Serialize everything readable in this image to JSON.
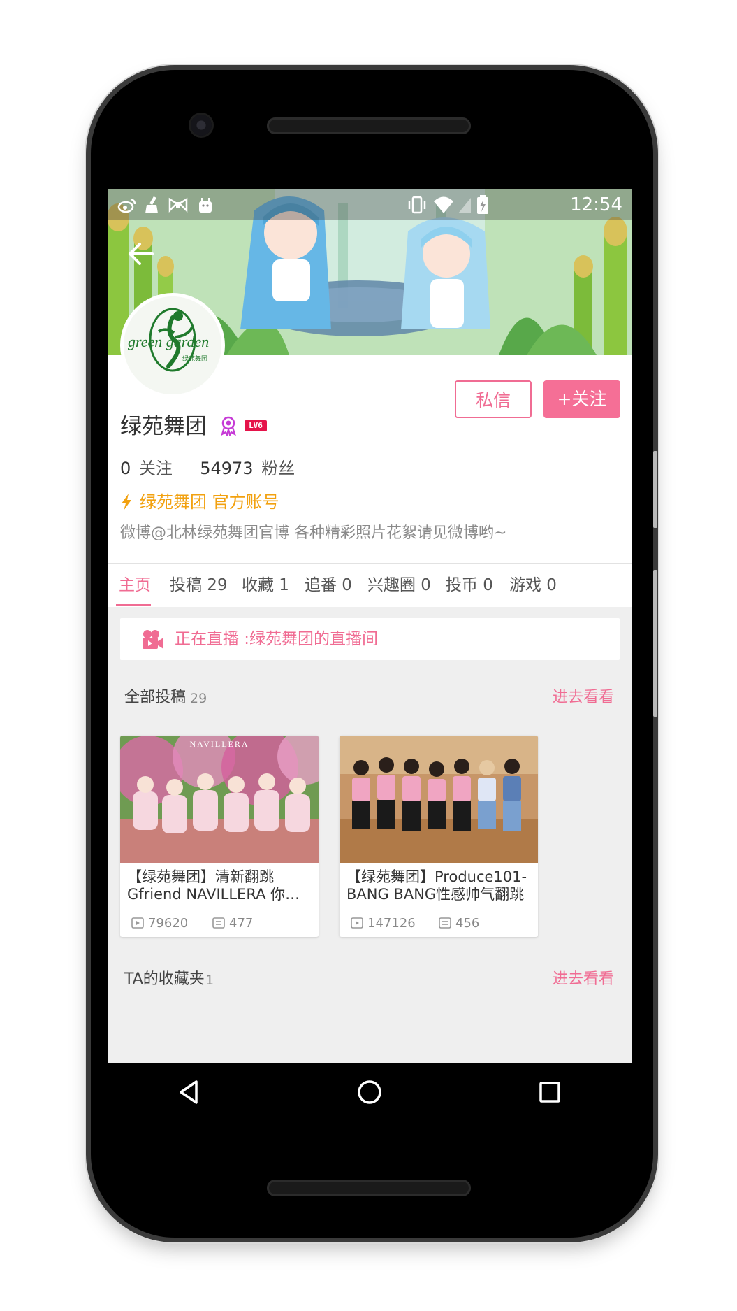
{
  "status_bar": {
    "time": "12:54",
    "left_icons": [
      "weibo-icon",
      "cleaner-icon",
      "bow-icon",
      "android-icon"
    ],
    "right_icons": [
      "vibrate-icon",
      "wifi-icon",
      "signal-icon",
      "battery-charging-icon"
    ]
  },
  "header": {
    "back_icon": "back-arrow-icon"
  },
  "profile": {
    "name": "绿苑舞团",
    "level": "LV6",
    "following_count": "0",
    "following_label": "关注",
    "followers_count": "54973",
    "followers_label": "粉丝",
    "official_label": "绿苑舞团 官方账号",
    "bio": "微博@北林绿苑舞团官博   各种精彩照片花絮请见微博哟~",
    "avatar_text_main": "green garden",
    "avatar_text_sub": "绿苑舞团"
  },
  "actions": {
    "message_label": "私信",
    "follow_label": "+关注"
  },
  "tabs": [
    {
      "label": "主页",
      "active": true
    },
    {
      "label": "投稿 29"
    },
    {
      "label": "收藏 1"
    },
    {
      "label": "追番 0"
    },
    {
      "label": "兴趣圈 0"
    },
    {
      "label": "投币 0"
    },
    {
      "label": "游戏 0"
    }
  ],
  "live": {
    "text": "正在直播 :绿苑舞团的直播间"
  },
  "submissions": {
    "title": "全部投稿",
    "count": "29",
    "more_label": "进去看看",
    "videos": [
      {
        "title_line1": "【绿苑舞团】清新翻跳",
        "title_line2": "Gfriend NAVILLERA 你还…",
        "thumb_caption": "NAVILLERA",
        "views": "79620",
        "comments": "477"
      },
      {
        "title_line1": "【绿苑舞团】Produce101-",
        "title_line2": "BANG BANG性感帅气翻跳",
        "views": "147126",
        "comments": "456"
      }
    ]
  },
  "favorites": {
    "title": "TA的收藏夹",
    "count": "1",
    "more_label": "进去看看"
  },
  "colors": {
    "accent": "#f06c93",
    "official": "#f2a10f",
    "level_badge": "#e5134a"
  }
}
